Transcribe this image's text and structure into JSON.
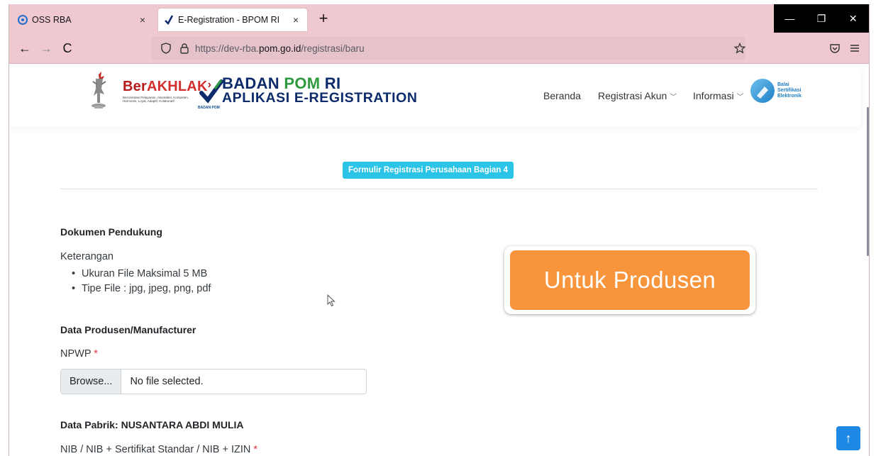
{
  "browser": {
    "tabs": [
      {
        "title": "OSS RBA",
        "close": "×"
      },
      {
        "title": "E-Registration - BPOM RI",
        "close": "×"
      }
    ],
    "new_tab": "+",
    "window_controls": {
      "minimize": "—",
      "restore": "❐",
      "close": "✕"
    },
    "nav": {
      "back": "←",
      "forward": "→",
      "reload": "C"
    },
    "url": {
      "prefix": "https://dev-rba.",
      "host": "pom.go.id",
      "path": "/registrasi/baru"
    }
  },
  "header": {
    "berakhlak": {
      "part1": "Ber",
      "part2": "AKHLAK",
      "tagline": "Berorientasi Pelayanan, Akuntabel, Kompeten, Harmonis, Loyal, Adaptif, Kolaboratif"
    },
    "bpom": {
      "line1_a": "BADAN ",
      "line1_b": "POM",
      "line1_c": " RI",
      "line2": "APLIKASI E-REGISTRATION",
      "small": "BADAN POM"
    },
    "menu": {
      "home": "Beranda",
      "register": "Registrasi Akun",
      "info": "Informasi",
      "chevron": "﹀"
    },
    "bse": {
      "l1": "Balai",
      "l2": "Sertifikasi",
      "l3": "Elektronik"
    }
  },
  "form": {
    "section_badge": "Formulir Registrasi Perusahaan Bagian 4",
    "supporting_docs_title": "Dokumen Pendukung",
    "notes_label": "Keterangan",
    "notes": [
      "Ukuran File Maksimal 5 MB",
      "Tipe File : jpg, jpeg, png, pdf"
    ],
    "manufacturer_title": "Data Produsen/Manufacturer",
    "npwp_label": "NPWP",
    "required_mark": "*",
    "browse_label": "Browse...",
    "file_status": "No file selected.",
    "factory_title": "Data Pabrik: NUSANTARA ABDI MULIA",
    "nib_label": "NIB / NIB + Sertifikat Standar / NIB + IZIN"
  },
  "callout": {
    "text": "Untuk Produsen",
    "color": "#f7943c"
  },
  "scroll_top": "↑",
  "colors": {
    "chrome": "#f0c8d0",
    "badge": "#2bc4e6",
    "scroll_top_btn": "#1e88e5"
  }
}
